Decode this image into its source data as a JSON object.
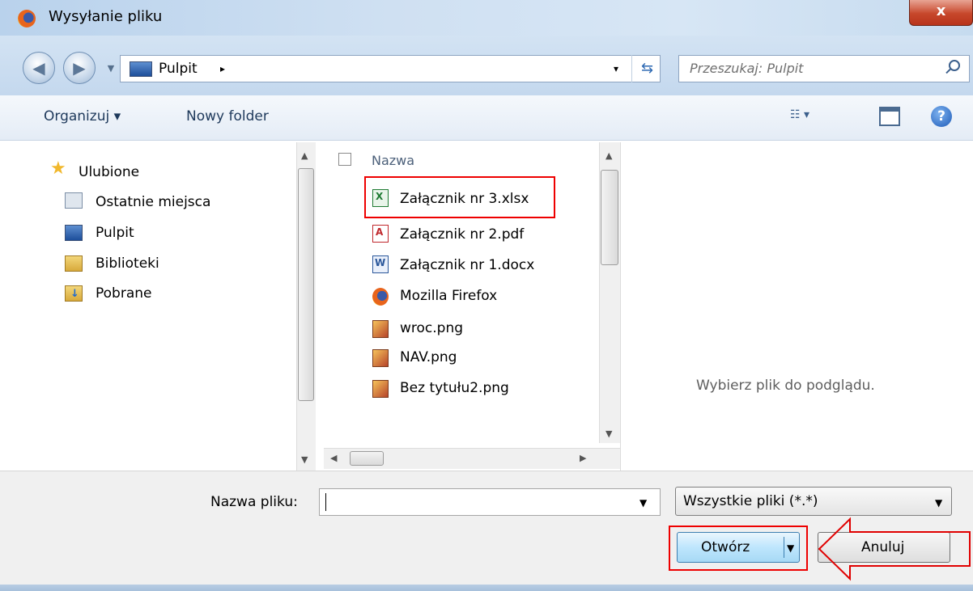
{
  "window": {
    "title": "Wysyłanie pliku",
    "close_label": "x"
  },
  "address": {
    "location": "Pulpit",
    "separator": "▸",
    "dropdown": "▾"
  },
  "search": {
    "placeholder": "Przeszukaj: Pulpit"
  },
  "toolbar": {
    "organize_label": "Organizuj ▾",
    "new_folder_label": "Nowy folder",
    "views_label": "☷ ▾",
    "help_label": "?"
  },
  "nav": {
    "items": [
      {
        "label": "Ulubione",
        "icon": "star-icon"
      },
      {
        "label": "Ostatnie miejsca",
        "icon": "recent-places-icon"
      },
      {
        "label": "Pulpit",
        "icon": "desktop-icon"
      },
      {
        "label": "Biblioteki",
        "icon": "libraries-icon"
      },
      {
        "label": "Pobrane",
        "icon": "downloads-icon"
      }
    ]
  },
  "file_list": {
    "header": "Nazwa",
    "items": [
      {
        "name": "Załącznik nr 3.xlsx",
        "icon": "excel-file-icon"
      },
      {
        "name": "Załącznik nr 2.pdf",
        "icon": "pdf-file-icon"
      },
      {
        "name": "Załącznik nr 1.docx",
        "icon": "word-file-icon"
      },
      {
        "name": "Mozilla Firefox",
        "icon": "firefox-shortcut-icon"
      },
      {
        "name": "wroc.png",
        "icon": "image-file-icon"
      },
      {
        "name": "NAV.png",
        "icon": "image-file-icon"
      },
      {
        "name": "Bez tytułu2.png",
        "icon": "image-file-icon"
      }
    ]
  },
  "preview": {
    "message": "Wybierz plik do podglądu."
  },
  "bottom": {
    "filename_label": "Nazwa pliku:",
    "filename_value": "",
    "file_type": "Wszystkie pliki (*.*)",
    "open_label": "Otwórz",
    "cancel_label": "Anuluj"
  },
  "colors": {
    "highlight": "#e00000",
    "accent": "#3c7fb1"
  }
}
